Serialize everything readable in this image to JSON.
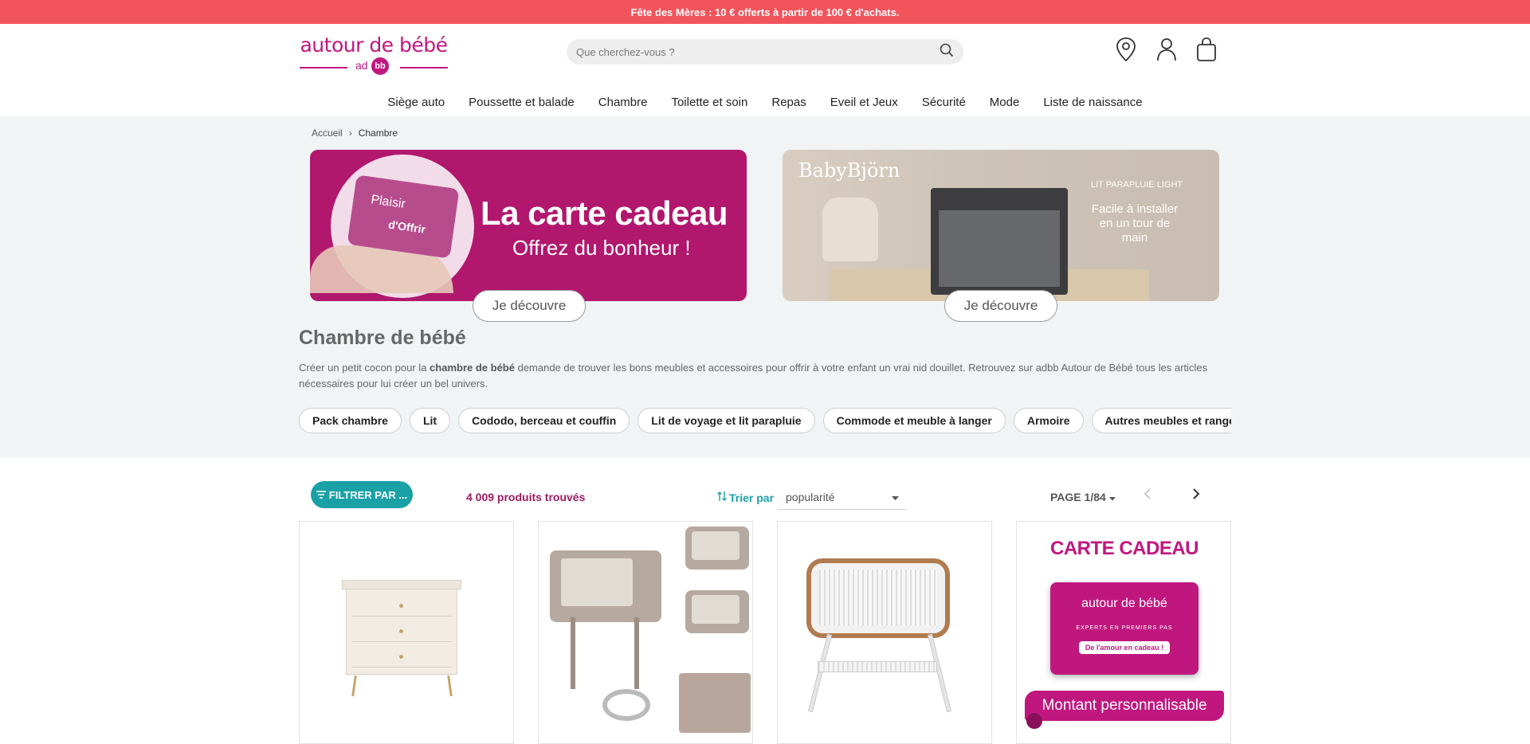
{
  "promo": {
    "text": "Fête des Mères : 10 € offerts à partir de 100 € d'achats."
  },
  "logo": {
    "name": "autour de bébé",
    "short_ad": "ad",
    "short_bb": "bb"
  },
  "search": {
    "placeholder": "Que cherchez-vous ?"
  },
  "header_icons": [
    "location-icon",
    "account-icon",
    "bag-icon"
  ],
  "nav": {
    "items": [
      "Siège auto",
      "Poussette et balade",
      "Chambre",
      "Toilette et soin",
      "Repas",
      "Eveil et Jeux",
      "Sécurité",
      "Mode",
      "Liste de naissance"
    ]
  },
  "breadcrumb": {
    "home": "Accueil",
    "separator": "›",
    "current": "Chambre"
  },
  "banners": {
    "gift": {
      "card_line1": "Plaisir",
      "card_line2": "d'Offrir",
      "title": "La carte cadeau",
      "subtitle": "Offrez du bonheur !",
      "button": "Je découvre"
    },
    "babybjorn": {
      "brand": "BabyBjörn",
      "kicker": "LIT PARAPLUIE LIGHT",
      "tagline": "Facile à installer en un tour de main",
      "button": "Je découvre"
    }
  },
  "category": {
    "title": "Chambre de bébé",
    "desc_before": "Créer un petit cocon pour la ",
    "desc_bold": "chambre de bébé",
    "desc_after": " demande de trouver les bons meubles et accessoires pour offrir à votre enfant un vrai nid douillet. Retrouvez sur adbb Autour de Bébé tous les articles nécessaires pour lui créer un bel univers.",
    "chips": [
      "Pack chambre",
      "Lit",
      "Cododo, berceau et couffin",
      "Lit de voyage et lit parapluie",
      "Commode et meuble à langer",
      "Armoire",
      "Autres meubles et rangement"
    ]
  },
  "toolbar": {
    "filter_label": "FILTRER PAR ...",
    "count": "4 009 produits trouvés",
    "sort_label": "Trier par",
    "sort_value": "popularité",
    "page_label": "PAGE 1/84"
  },
  "products": {
    "gift_card": {
      "title": "CARTE CADEAU",
      "brand": "autour de bébé",
      "tagline": "EXPERTS EN PREMIERS PAS",
      "slogan": "De l'amour en cadeau !",
      "amount_label": "Montant personnalisable"
    }
  },
  "colors": {
    "promo": "#f2545b",
    "brand": "#c0177f",
    "teal": "#1aa1a6",
    "count": "#9c1a62",
    "hero_bg": "#f0f4f5"
  }
}
